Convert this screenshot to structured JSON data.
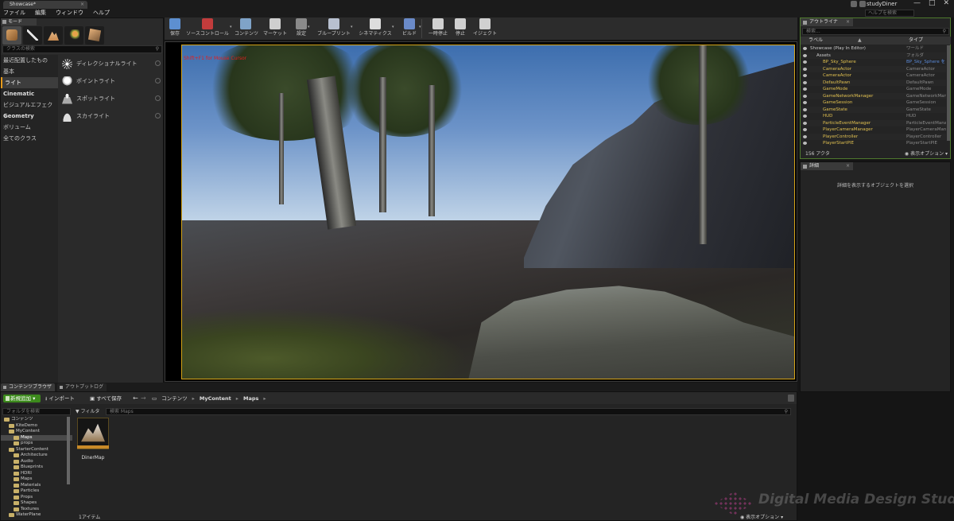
{
  "window": {
    "doc_tab": "Showcase*",
    "project": "studyDiner",
    "help_search": "ヘルプを検索",
    "buttons": [
      "—",
      "□",
      "✕"
    ]
  },
  "menu": [
    "ファイル",
    "編集",
    "ウィンドウ",
    "ヘルプ"
  ],
  "modes": {
    "tab": "モード",
    "class_search": "クラスの検索",
    "categories": [
      {
        "label": "最近配置したもの"
      },
      {
        "label": "基本"
      },
      {
        "label": "ライト",
        "selected": true
      },
      {
        "label": "Cinematic",
        "bold": true
      },
      {
        "label": "ビジュアルエフェクト"
      },
      {
        "label": "Geometry",
        "bold": true
      },
      {
        "label": "ボリューム"
      },
      {
        "label": "全てのクラス"
      }
    ],
    "items": [
      {
        "label": "ディレクショナルライト",
        "icon": "directional-light-icon"
      },
      {
        "label": "ポイントライト",
        "icon": "point-light-icon"
      },
      {
        "label": "スポットライト",
        "icon": "spot-light-icon"
      },
      {
        "label": "スカイライト",
        "icon": "sky-light-icon"
      }
    ]
  },
  "toolbar": [
    {
      "label": "保存",
      "icon": "save-icon",
      "color": "#5d8fd0"
    },
    {
      "label": "ソースコントロール",
      "icon": "source-control-icon",
      "color": "#c23c3c"
    },
    {
      "label": "コンテンツ",
      "icon": "content-icon",
      "color": "#7fa3c8"
    },
    {
      "label": "マーケット",
      "icon": "market-icon",
      "color": "#cfcfcf"
    },
    {
      "label": "設定",
      "icon": "settings-icon",
      "color": "#8a8a8a"
    },
    {
      "label": "ブループリント",
      "icon": "blueprint-icon",
      "color": "#b8c0d0"
    },
    {
      "label": "シネマティクス",
      "icon": "cinematics-icon",
      "color": "#dddddd"
    },
    {
      "label": "ビルド",
      "icon": "build-icon",
      "color": "#6a8ac8"
    },
    {
      "label": "一時停止",
      "icon": "pause-icon",
      "color": "#d0d0d0"
    },
    {
      "label": "停止",
      "icon": "stop-icon",
      "color": "#d0d0d0"
    },
    {
      "label": "イジェクト",
      "icon": "eject-icon",
      "color": "#d0d0d0"
    }
  ],
  "viewport": {
    "stat_text": "Shift+F1 for Mouse Cursor"
  },
  "outliner": {
    "tab": "アウトライナ",
    "search_placeholder": "検索...",
    "col_label": "ラベル",
    "col_type": "タイプ",
    "rows": [
      {
        "name": "Showcase (Play In Editor)",
        "type": "ワールド",
        "indent": 0,
        "folder": true
      },
      {
        "name": "Assets",
        "type": "フォルダ",
        "indent": 1,
        "folder": true
      },
      {
        "name": "BP_Sky_Sphere",
        "type": "BP_Sky_Sphere を",
        "indent": 2,
        "link": true
      },
      {
        "name": "CameraActor",
        "type": "CameraActor",
        "indent": 2
      },
      {
        "name": "CameraActor",
        "type": "CameraActor",
        "indent": 2
      },
      {
        "name": "DefaultPawn",
        "type": "DefaultPawn",
        "indent": 2
      },
      {
        "name": "GameMode",
        "type": "GameMode",
        "indent": 2
      },
      {
        "name": "GameNetworkManager",
        "type": "GameNetworkManager",
        "indent": 2
      },
      {
        "name": "GameSession",
        "type": "GameSession",
        "indent": 2
      },
      {
        "name": "GameState",
        "type": "GameState",
        "indent": 2
      },
      {
        "name": "HUD",
        "type": "HUD",
        "indent": 2
      },
      {
        "name": "ParticleEventManager",
        "type": "ParticleEventManager",
        "indent": 2
      },
      {
        "name": "PlayerCameraManager",
        "type": "PlayerCameraManage",
        "indent": 2
      },
      {
        "name": "PlayerController",
        "type": "PlayerController",
        "indent": 2
      },
      {
        "name": "PlayerStartPIE",
        "type": "PlayerStartPIE",
        "indent": 2
      }
    ],
    "count": "156 アクタ",
    "view_options": "表示オプション"
  },
  "details": {
    "tab": "詳細",
    "hint": "詳細を表示するオブジェクトを選択"
  },
  "content_tabs": [
    "コンテンツブラウザ",
    "アウトプットログ"
  ],
  "content": {
    "add_new": "新規追加",
    "import": "インポート",
    "save_all": "すべて保存",
    "breadcrumb": [
      "コンテンツ",
      "MyContent",
      "Maps"
    ],
    "folder_search": "フォルダを検索",
    "filters": "フィルタ",
    "asset_search": "検索 Maps",
    "tree": [
      {
        "label": "コンテンツ",
        "indent": 0
      },
      {
        "label": "KiteDemo",
        "indent": 1
      },
      {
        "label": "MyContent",
        "indent": 1
      },
      {
        "label": "Maps",
        "indent": 2,
        "selected": true
      },
      {
        "label": "props",
        "indent": 2
      },
      {
        "label": "StarterContent",
        "indent": 1
      },
      {
        "label": "Architecture",
        "indent": 2
      },
      {
        "label": "Audio",
        "indent": 2
      },
      {
        "label": "Blueprints",
        "indent": 2
      },
      {
        "label": "HDRI",
        "indent": 2
      },
      {
        "label": "Maps",
        "indent": 2
      },
      {
        "label": "Materials",
        "indent": 2
      },
      {
        "label": "Particles",
        "indent": 2
      },
      {
        "label": "Props",
        "indent": 2
      },
      {
        "label": "Shapes",
        "indent": 2
      },
      {
        "label": "Textures",
        "indent": 2
      },
      {
        "label": "WaterPlane",
        "indent": 1
      }
    ],
    "assets": [
      {
        "name": "DinerMap"
      }
    ],
    "item_count": "1アイテム",
    "view_options": "表示オプション"
  },
  "watermark": "Digital Media Design Studio"
}
